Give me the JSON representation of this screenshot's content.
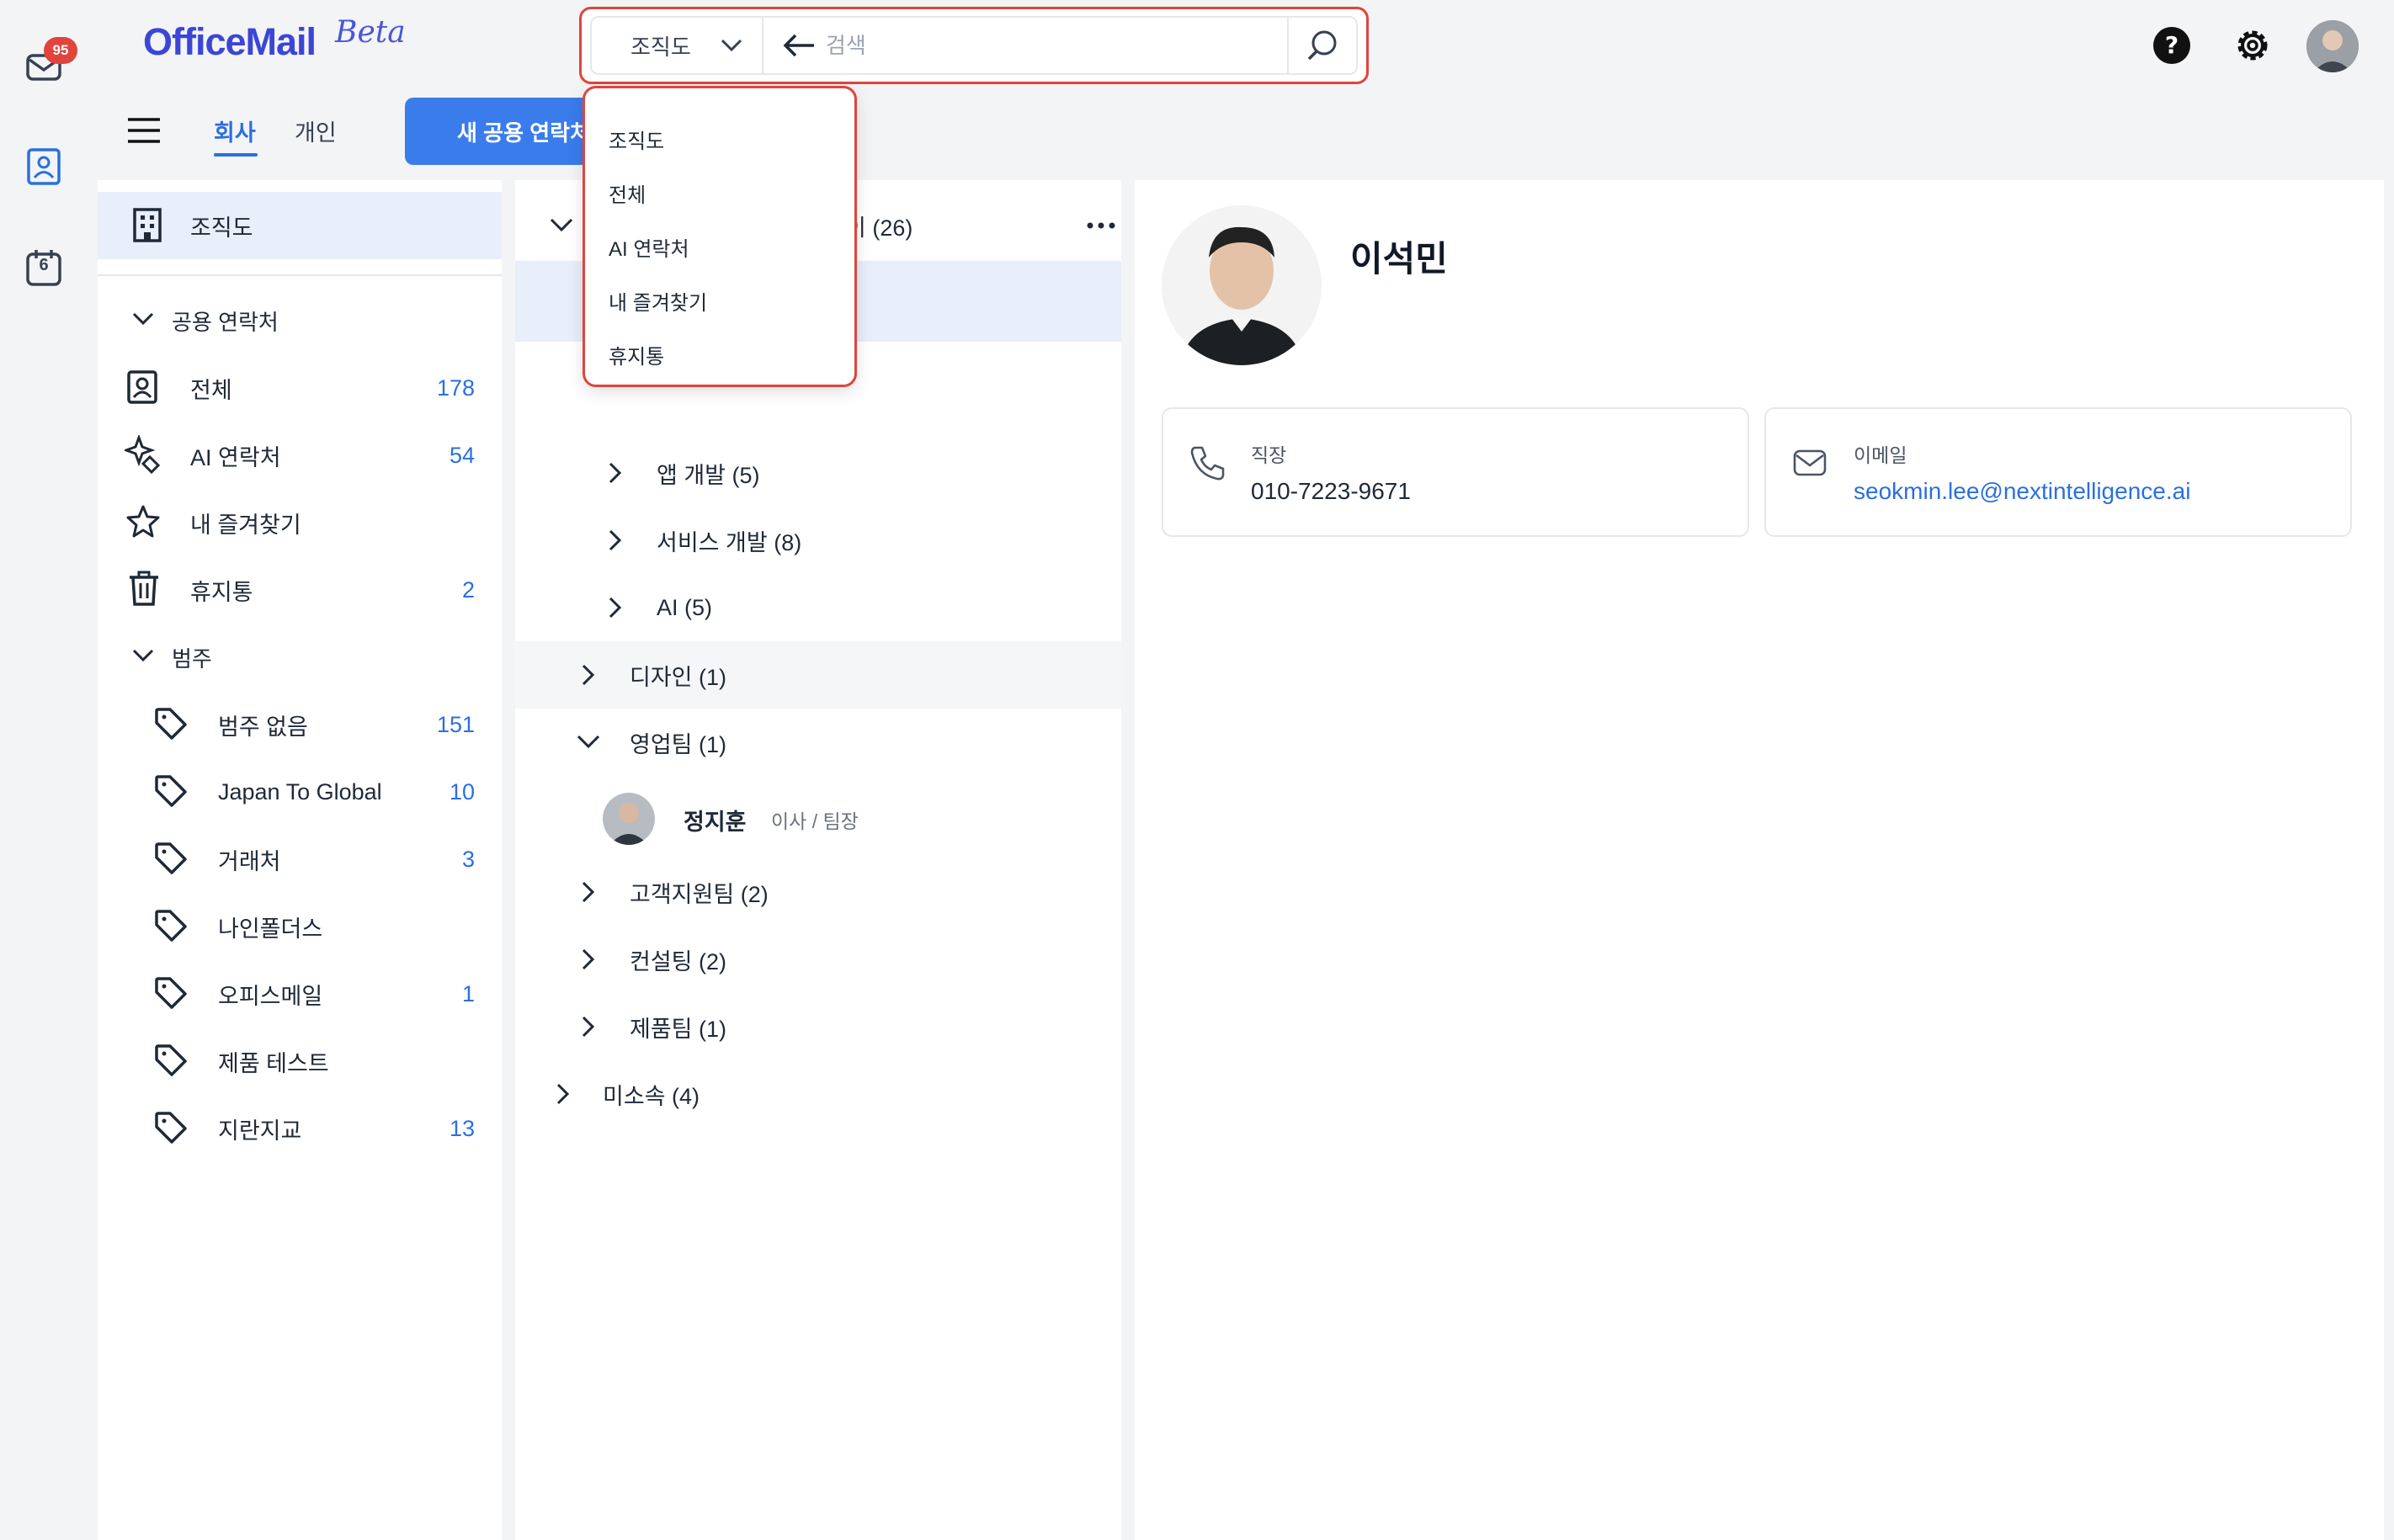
{
  "app": {
    "logo": "OfficeMail",
    "logo_suffix": "Beta",
    "mail_badge": "95",
    "calendar_day": "6"
  },
  "search": {
    "scope_selected": "조직도",
    "placeholder": "검색",
    "scope_options": [
      "조직도",
      "전체",
      "AI 연락처",
      "내 즐겨찾기",
      "휴지통"
    ]
  },
  "tabs": [
    {
      "label": "회사",
      "active": true
    },
    {
      "label": "개인",
      "active": false
    }
  ],
  "new_button": "새 공용 연락처",
  "sidebar": {
    "org_label": "조직도",
    "shared_section": "공용 연락처",
    "shared_items": [
      {
        "label": "전체",
        "count": "178",
        "icon": "contact-card-icon"
      },
      {
        "label": "AI 연락처",
        "count": "54",
        "icon": "ai-sparkle-icon"
      },
      {
        "label": "내 즐겨찾기",
        "count": "",
        "icon": "star-icon"
      },
      {
        "label": "휴지통",
        "count": "2",
        "icon": "trash-icon"
      }
    ],
    "category_section": "범주",
    "categories": [
      {
        "label": "범주 없음",
        "count": "151"
      },
      {
        "label": "Japan To Global",
        "count": "10"
      },
      {
        "label": "거래처",
        "count": "3"
      },
      {
        "label": "나인폴더스",
        "count": ""
      },
      {
        "label": "오피스메일",
        "count": "1"
      },
      {
        "label": "제품 테스트",
        "count": ""
      },
      {
        "label": "지란지교",
        "count": "13"
      }
    ]
  },
  "tree": {
    "root_label_partial": "이 (26)",
    "items": [
      {
        "label": "앱 개발 (5)",
        "level": 2,
        "expanded": false
      },
      {
        "label": "서비스 개발 (8)",
        "level": 2,
        "expanded": false
      },
      {
        "label": "AI (5)",
        "level": 2,
        "expanded": false
      },
      {
        "label": "디자인 (1)",
        "level": 1,
        "expanded": false
      },
      {
        "label": "영업팀 (1)",
        "level": 1,
        "expanded": true
      }
    ],
    "member": {
      "name": "정지훈",
      "title": "이사 / 팀장"
    },
    "items_after": [
      {
        "label": "고객지원팀 (2)",
        "level": 1
      },
      {
        "label": "컨설팅 (2)",
        "level": 1
      },
      {
        "label": "제품팀 (1)",
        "level": 1
      },
      {
        "label": "미소속 (4)",
        "level": 0
      }
    ]
  },
  "detail": {
    "name": "이석민",
    "phone_label": "직장",
    "phone": "010-7223-9671",
    "email_label": "이메일",
    "email": "seokmin.lee@nextintelligence.ai"
  },
  "colors": {
    "accent": "#2b6fe0",
    "highlight": "#e0443c",
    "selected_bg": "#e8eefa"
  }
}
